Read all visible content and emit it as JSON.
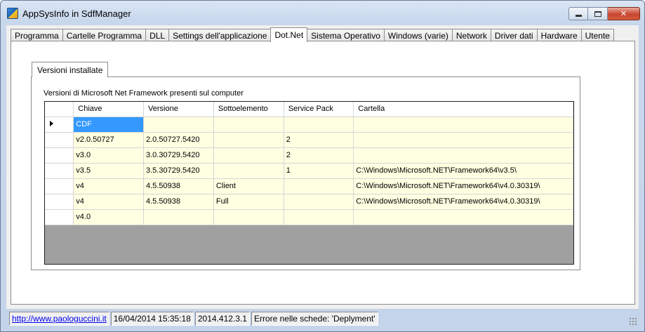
{
  "window": {
    "title": "AppSysInfo in SdfManager",
    "icon": "app-icon",
    "controls": [
      "minimize-icon",
      "maximize-icon",
      "close-icon"
    ]
  },
  "tabs": [
    {
      "label": "Programma",
      "active": false
    },
    {
      "label": "Cartelle Programma",
      "active": false
    },
    {
      "label": "DLL",
      "active": false
    },
    {
      "label": "Settings dell'applicazione",
      "active": false
    },
    {
      "label": "Dot.Net",
      "active": true
    },
    {
      "label": "Sistema Operativo",
      "active": false
    },
    {
      "label": "Windows (varie)",
      "active": false
    },
    {
      "label": "Network",
      "active": false
    },
    {
      "label": "Driver dati",
      "active": false
    },
    {
      "label": "Hardware",
      "active": false
    },
    {
      "label": "Utente",
      "active": false
    }
  ],
  "inner_tab": {
    "label": "Versioni installate"
  },
  "grid": {
    "caption": "Versioni di Microsoft Net Framework presenti sul computer",
    "columns": [
      "Chiave",
      "Versione",
      "Sottoelemento",
      "Service Pack",
      "Cartella"
    ],
    "rows": [
      [
        "CDF",
        "",
        "",
        "",
        ""
      ],
      [
        "v2.0.50727",
        "2.0.50727.5420",
        "",
        "2",
        ""
      ],
      [
        "v3.0",
        "3.0.30729.5420",
        "",
        "2",
        ""
      ],
      [
        "v3.5",
        "3.5.30729.5420",
        "",
        "1",
        "C:\\Windows\\Microsoft.NET\\Framework64\\v3.5\\"
      ],
      [
        "v4",
        "4.5.50938",
        "Client",
        "",
        "C:\\Windows\\Microsoft.NET\\Framework64\\v4.0.30319\\"
      ],
      [
        "v4",
        "4.5.50938",
        "Full",
        "",
        "C:\\Windows\\Microsoft.NET\\Framework64\\v4.0.30319\\"
      ],
      [
        "v4.0",
        "",
        "",
        "",
        ""
      ]
    ],
    "current_row": 0,
    "colors": {
      "cell_bg": "#ffffe1",
      "selected_bg": "#3399ff",
      "empty_area": "#a0a0a0"
    }
  },
  "statusbar": {
    "link": "http://www.paologuccini.it",
    "datetime": "16/04/2014 15:35:18",
    "version": "2014.412.3.1",
    "message": "Errore nelle schede: 'Deplyment'"
  }
}
